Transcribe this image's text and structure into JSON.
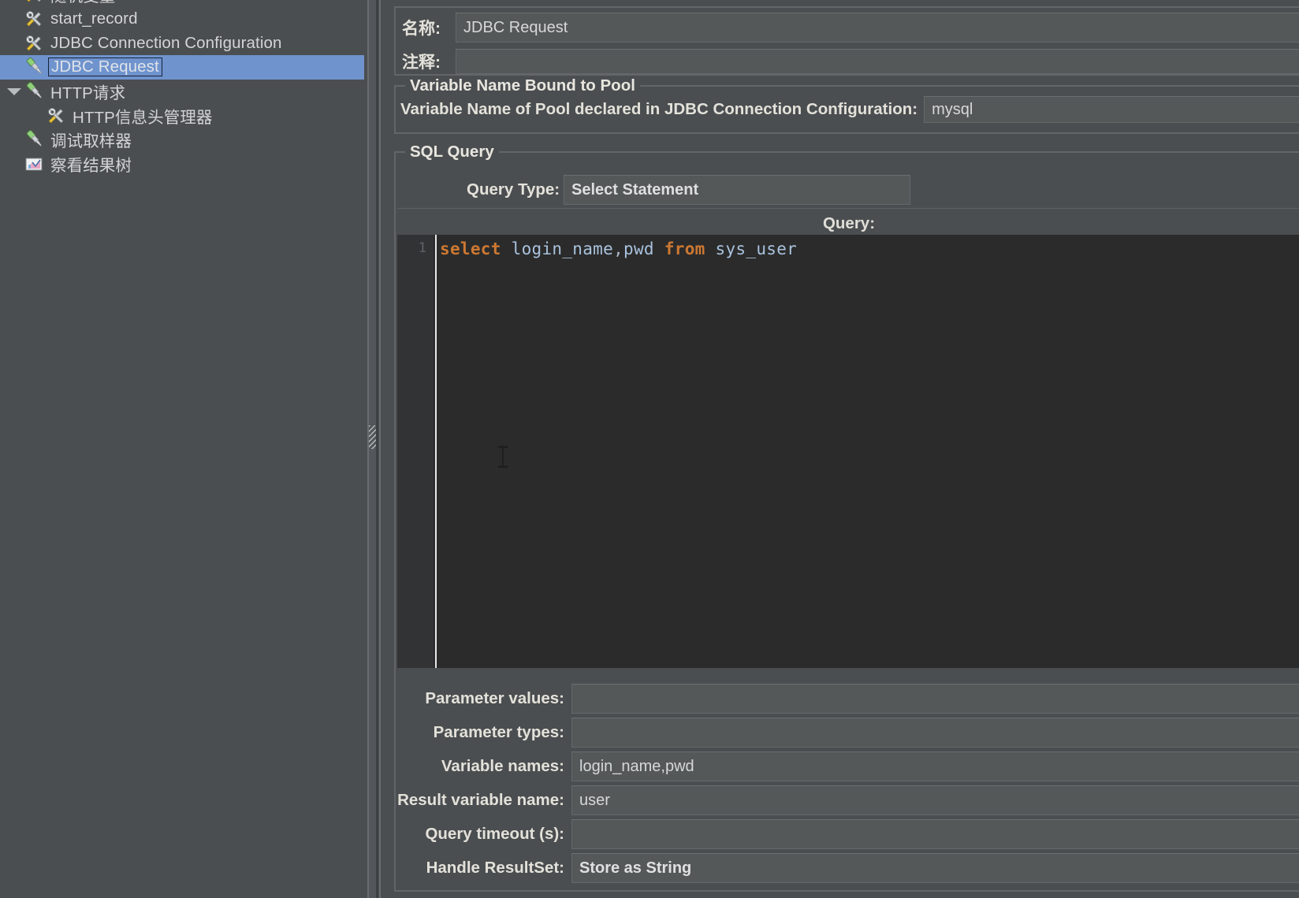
{
  "tree": {
    "items": [
      {
        "label": "随机变量",
        "icon": "config-element-icon",
        "indent": 0,
        "selected": false,
        "twisty": "none",
        "clipped_top": false
      },
      {
        "label": "start_record",
        "icon": "config-element-icon",
        "indent": 0,
        "selected": false,
        "twisty": "none",
        "clipped_top": false
      },
      {
        "label": "JDBC Connection Configuration",
        "icon": "config-element-icon",
        "indent": 0,
        "selected": false,
        "twisty": "none",
        "clipped_top": false
      },
      {
        "label": "JDBC Request",
        "icon": "sampler-icon",
        "indent": 0,
        "selected": true,
        "twisty": "none",
        "clipped_top": false
      },
      {
        "label": "HTTP请求",
        "icon": "sampler-icon",
        "indent": 0,
        "selected": false,
        "twisty": "open",
        "clipped_top": false
      },
      {
        "label": "HTTP信息头管理器",
        "icon": "config-element-icon",
        "indent": 1,
        "selected": false,
        "twisty": "none",
        "clipped_top": false
      },
      {
        "label": "调试取样器",
        "icon": "sampler-icon",
        "indent": 0,
        "selected": false,
        "twisty": "none",
        "clipped_top": false
      },
      {
        "label": "察看结果树",
        "icon": "view-results-tree-icon",
        "indent": 0,
        "selected": false,
        "twisty": "none",
        "clipped_top": false
      }
    ]
  },
  "form": {
    "name_label": "名称:",
    "name_value": "JDBC Request",
    "comment_label": "注释:",
    "comment_value": "",
    "pool_group_title": "Variable Name Bound to Pool",
    "pool_label": "Variable Name of Pool declared in JDBC Connection Configuration:",
    "pool_value": "mysql",
    "sql_group_title": "SQL Query",
    "query_type_label": "Query Type:",
    "query_type_value": "Select Statement",
    "query_caption": "Query:",
    "editor": {
      "line_number": "1",
      "tokens": [
        {
          "text": "select",
          "type": "keyword"
        },
        {
          "text": " ",
          "type": "plain"
        },
        {
          "text": "login_name",
          "type": "identifier"
        },
        {
          "text": ",",
          "type": "plain"
        },
        {
          "text": "pwd",
          "type": "identifier"
        },
        {
          "text": " ",
          "type": "plain"
        },
        {
          "text": "from",
          "type": "keyword"
        },
        {
          "text": " ",
          "type": "plain"
        },
        {
          "text": "sys_user",
          "type": "identifier"
        }
      ],
      "plain_text": "select login_name,pwd from sys_user"
    },
    "params": [
      {
        "label": "Parameter values:",
        "value": "",
        "bold": false
      },
      {
        "label": "Parameter types:",
        "value": "",
        "bold": false
      },
      {
        "label": "Variable names:",
        "value": "login_name,pwd",
        "bold": false
      },
      {
        "label": "Result variable name:",
        "value": "user",
        "bold": false
      },
      {
        "label": "Query timeout (s):",
        "value": "",
        "bold": false
      },
      {
        "label": "Handle ResultSet:",
        "value": "Store as String",
        "bold": true
      }
    ]
  },
  "colors": {
    "window_bg": "#4b4e50",
    "field_bg": "#555859",
    "selection_blue": "#6f93cd",
    "editor_bg": "#2b2b2b",
    "gutter_bg": "#313335",
    "keyword_orange": "#cc7832",
    "identifier_blue": "#a9c3de",
    "label_text": "#e3e1da"
  }
}
